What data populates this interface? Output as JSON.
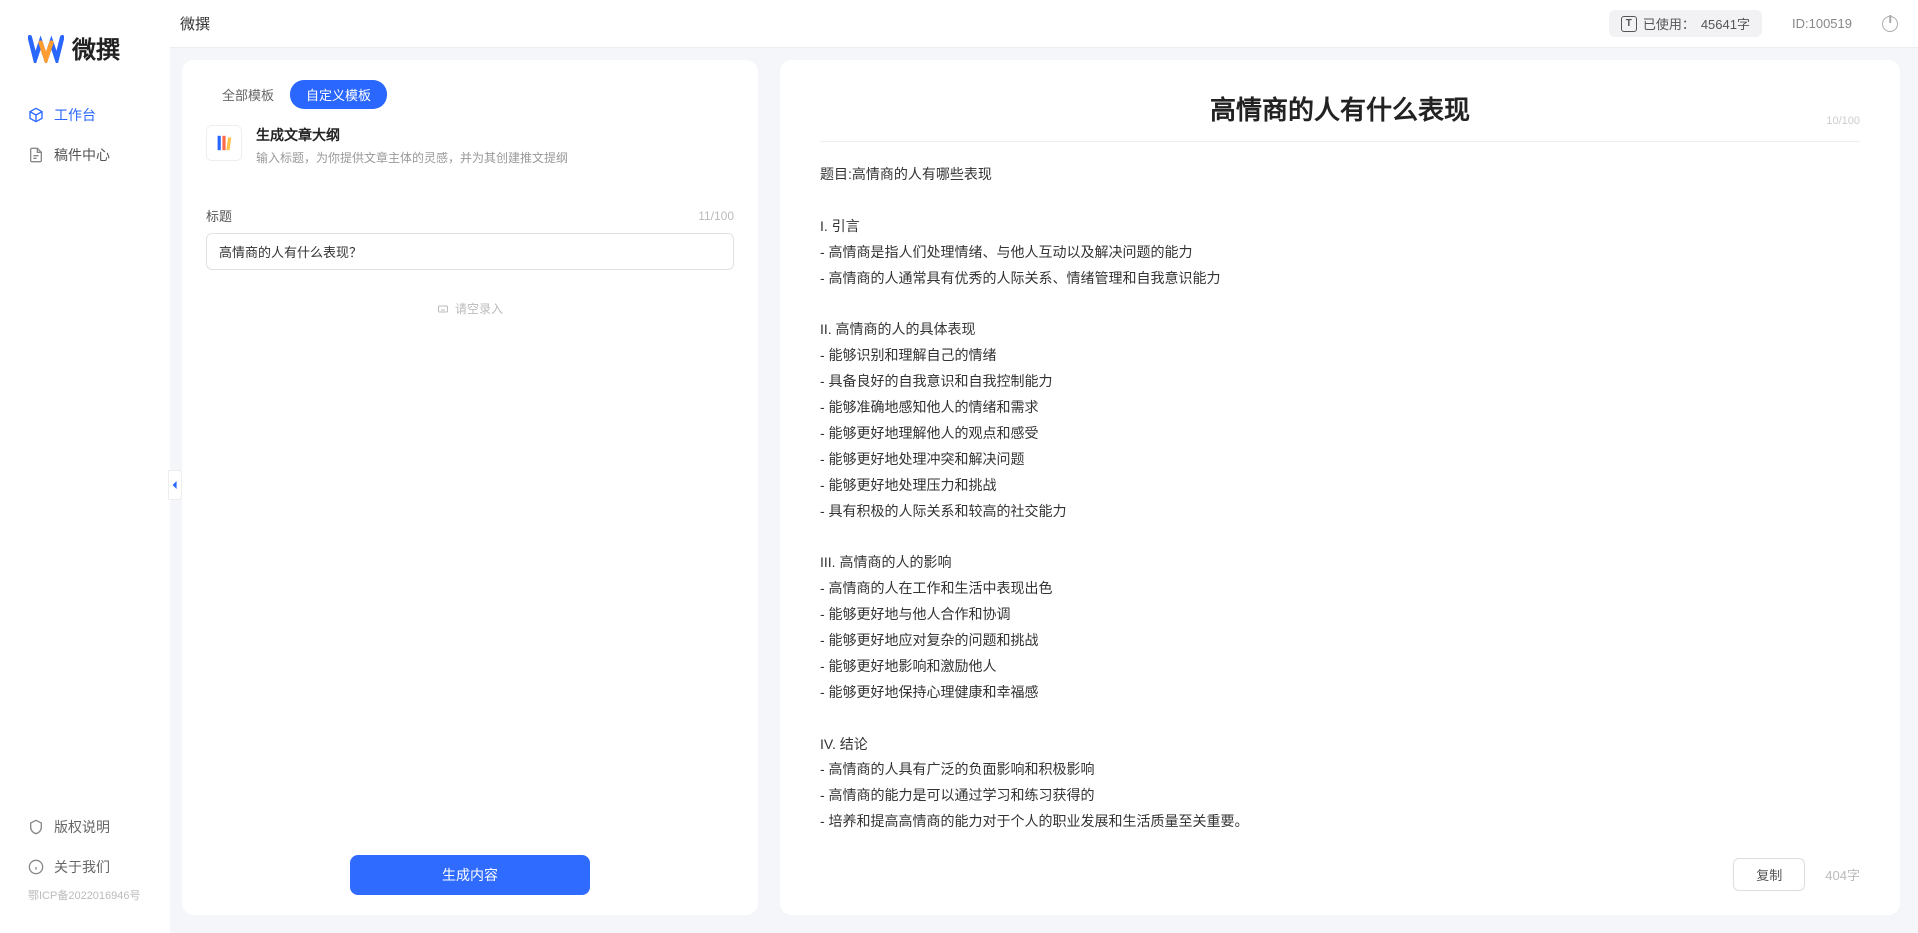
{
  "app": {
    "title": "微撰",
    "logoText": "微撰"
  },
  "header": {
    "usagePrefix": "已使用：",
    "usageCount": "45641字",
    "userIdLabel": "ID:",
    "userId": "100519"
  },
  "sidebar": {
    "nav": [
      {
        "label": "工作台",
        "active": true
      },
      {
        "label": "稿件中心",
        "active": false
      }
    ],
    "footer": [
      {
        "label": "版权说明"
      },
      {
        "label": "关于我们"
      }
    ],
    "icp": "鄂ICP备2022016946号"
  },
  "leftPanel": {
    "tabs": [
      {
        "label": "全部模板",
        "active": false
      },
      {
        "label": "自定义模板",
        "active": true
      }
    ],
    "template": {
      "name": "生成文章大纲",
      "desc": "输入标题，为你提供文章主体的灵感，并为其创建推文提纲"
    },
    "titleLabel": "标题",
    "titleCount": "11/100",
    "titleValue": "高情商的人有什么表现？",
    "recordHint": "请空录入",
    "generateBtn": "生成内容"
  },
  "output": {
    "title": "高情商的人有什么表现",
    "titleCount": "10/100",
    "body": "题目:高情商的人有哪些表现\n\nI. 引言\n- 高情商是指人们处理情绪、与他人互动以及解决问题的能力\n- 高情商的人通常具有优秀的人际关系、情绪管理和自我意识能力\n\nII. 高情商的人的具体表现\n- 能够识别和理解自己的情绪\n- 具备良好的自我意识和自我控制能力\n- 能够准确地感知他人的情绪和需求\n- 能够更好地理解他人的观点和感受\n- 能够更好地处理冲突和解决问题\n- 能够更好地处理压力和挑战\n- 具有积极的人际关系和较高的社交能力\n\nIII. 高情商的人的影响\n- 高情商的人在工作和生活中表现出色\n- 能够更好地与他人合作和协调\n- 能够更好地应对复杂的问题和挑战\n- 能够更好地影响和激励他人\n- 能够更好地保持心理健康和幸福感\n\nIV. 结论\n- 高情商的人具有广泛的负面影响和积极影响\n- 高情商的能力是可以通过学习和练习获得的\n- 培养和提高高情商的能力对于个人的职业发展和生活质量至关重要。",
    "copyBtn": "复制",
    "wordCount": "404字"
  }
}
